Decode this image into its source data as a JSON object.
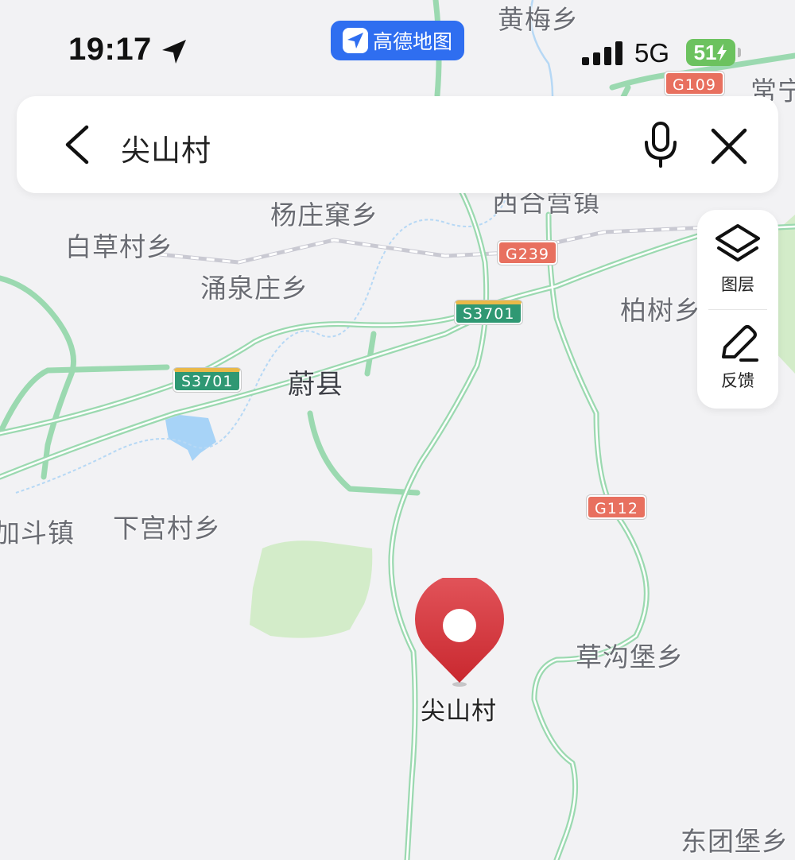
{
  "status_bar": {
    "time": "19:17",
    "network": "5G",
    "battery": "51"
  },
  "app_badge": {
    "name": "高德地图"
  },
  "search": {
    "query": "尖山村"
  },
  "side_tools": {
    "layers_label": "图层",
    "feedback_label": "反馈"
  },
  "map": {
    "places": [
      "黄梅乡",
      "常宁",
      "西合营镇",
      "杨庄窠乡",
      "白草村乡",
      "涌泉庄乡",
      "柏树乡",
      "蔚县",
      "下宫村乡",
      "加斗镇",
      "草沟堡乡",
      "东团堡乡"
    ],
    "road_shields": [
      "G109",
      "G239",
      "S3701",
      "S3701",
      "G112"
    ],
    "marker_label": "尖山村"
  },
  "colors": {
    "accent": "#2f6ef0",
    "marker": "#d93a3f",
    "national_road": "#e8705f",
    "provincial_road": "#2f9873",
    "battery": "#6cc25f"
  }
}
